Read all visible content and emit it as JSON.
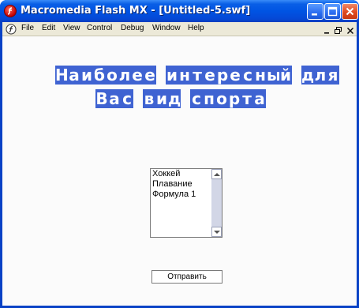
{
  "window": {
    "title": "Macromedia Flash MX - [Untitled-5.swf]"
  },
  "menu": {
    "items": [
      "File",
      "Edit",
      "View",
      "Control",
      "Debug",
      "Window",
      "Help"
    ]
  },
  "banner": {
    "line1_words": [
      "Наиболее",
      "интересный",
      "для"
    ],
    "line2_words": [
      "Вас",
      "вид",
      "спорта"
    ],
    "tile_color": "#3f63d2"
  },
  "sports_list": {
    "options": [
      "Хоккей",
      "Плавание",
      "Формула 1"
    ]
  },
  "submit": {
    "label": "Отправить"
  },
  "colors": {
    "titlebar": "#0054e3",
    "menubar": "#ece9d8"
  }
}
